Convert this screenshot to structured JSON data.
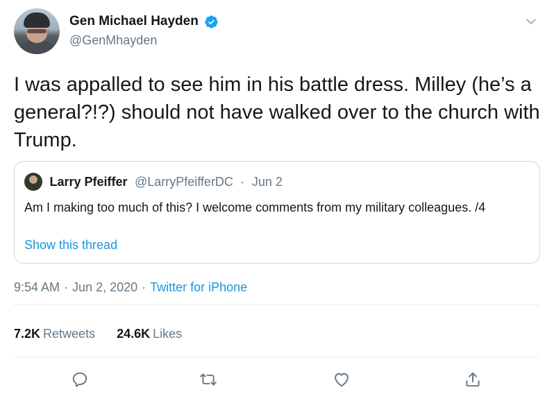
{
  "tweet": {
    "author": {
      "display_name": "Gen Michael Hayden",
      "handle": "@GenMhayden",
      "verified": true
    },
    "text": "I was appalled to see him in his battle dress. Milley (he’s a general?!?) should not have walked over to the church with Trump.",
    "quoted": {
      "display_name": "Larry Pfeiffer",
      "handle": "@LarryPfeifferDC",
      "separator": "·",
      "date": "Jun 2",
      "text": "Am I making too much of this?  I welcome comments from my military colleagues. /4",
      "thread_link": "Show this thread"
    },
    "meta": {
      "time": "9:54 AM",
      "separator": "·",
      "date": "Jun 2, 2020",
      "source": "Twitter for iPhone"
    },
    "stats": {
      "retweets_count": "7.2K",
      "retweets_label": "Retweets",
      "likes_count": "24.6K",
      "likes_label": "Likes"
    }
  },
  "icons": {
    "verified": "verified-badge-icon",
    "caret": "chevron-down-icon",
    "reply": "reply-icon",
    "retweet": "retweet-icon",
    "like": "heart-icon",
    "share": "share-icon"
  },
  "colors": {
    "text": "#14171a",
    "secondary": "#657786",
    "link": "#1b95e0",
    "verified": "#1da1f2",
    "border": "#ccd6dd",
    "divider": "#e6ecf0"
  }
}
